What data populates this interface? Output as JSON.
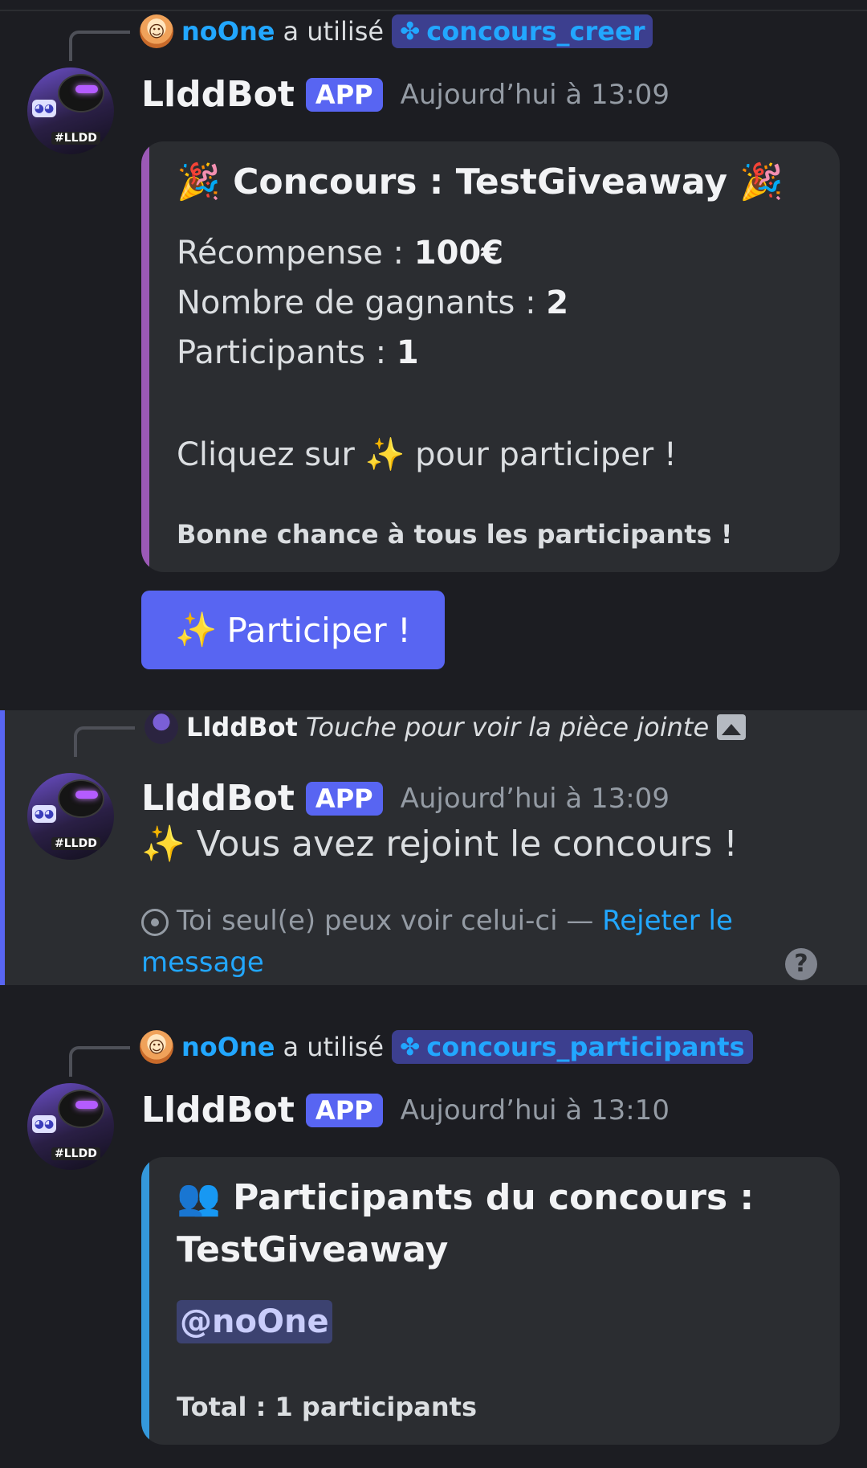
{
  "message1": {
    "reply": {
      "user": "noOne",
      "used_text": "a utilisé",
      "command": "concours_creer"
    },
    "bot_name": "LlddBot",
    "badge": "APP",
    "time": "Aujourd’hui à 13:09",
    "embed": {
      "title": "🎉 Concours : TestGiveaway 🎉",
      "reward_label": "Récompense : ",
      "reward_value": "100€",
      "winners_label": "Nombre de gagnants : ",
      "winners_value": "2",
      "participants_label": "Participants : ",
      "participants_value": "1",
      "cta_pre": "Cliquez sur ",
      "cta_emoji": "✨",
      "cta_post": " pour participer !",
      "footer": "Bonne chance à tous les participants !",
      "accent_color": "#9b59b6"
    },
    "button": {
      "emoji": "✨",
      "label": "Participer !"
    }
  },
  "message2": {
    "reply": {
      "bot_name": "LlddBot",
      "text": "Touche pour voir la pièce jointe"
    },
    "bot_name": "LlddBot",
    "badge": "APP",
    "time": "Aujourd’hui à 13:09",
    "content": "✨ Vous avez rejoint le concours !",
    "note": "Toi seul(e) peux voir celui-ci — ",
    "dismiss": "Rejeter le message",
    "help": "?"
  },
  "message3": {
    "reply": {
      "user": "noOne",
      "used_text": "a utilisé",
      "command": "concours_participants"
    },
    "bot_name": "LlddBot",
    "badge": "APP",
    "time": "Aujourd’hui à 13:10",
    "embed": {
      "title_line1": "👥 Participants du concours :",
      "title_line2": "TestGiveaway",
      "mention": "@noOne",
      "footer": "Total : 1 participants",
      "accent_color": "#3498db"
    }
  }
}
